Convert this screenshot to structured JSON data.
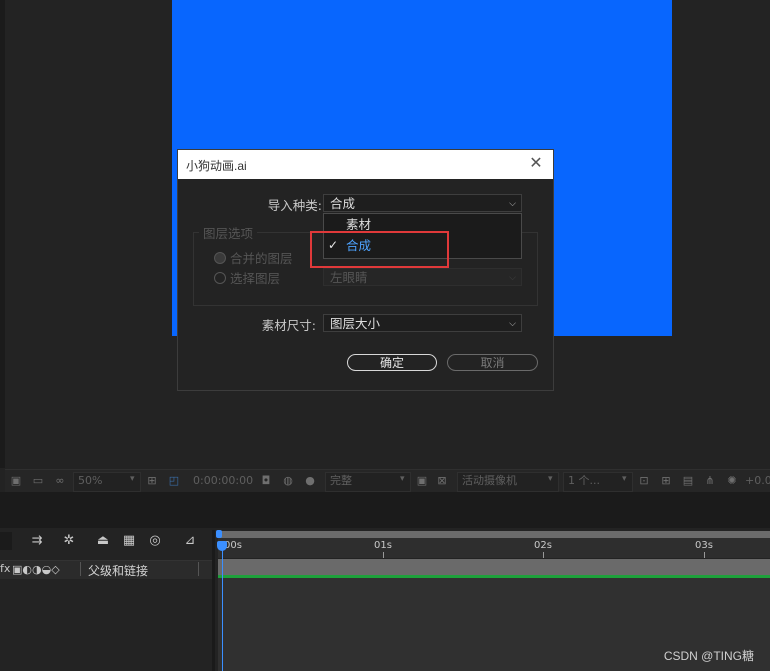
{
  "dialog": {
    "title": "小狗动画.ai",
    "close_glyph": "✕",
    "import_kind_label": "导入种类:",
    "import_kind_value": "合成",
    "layer_options_legend": "图层选项",
    "merge_layers_label": "合并的图层",
    "choose_layers_label": "选择图层",
    "layer_select_value": "左眼睛",
    "footage_size_label": "素材尺寸:",
    "footage_size_value": "图层大小",
    "ok_label": "确定",
    "cancel_label": "取消",
    "dropdown_options": [
      {
        "label": "素材",
        "checked": false
      },
      {
        "label": "合成",
        "checked": true
      }
    ],
    "check_glyph": "✓"
  },
  "viewer_toolbar": {
    "zoom_value": "50%",
    "timecode": "0:00:00:00",
    "resolution_value": "完整",
    "camera_value": "活动摄像机",
    "views_value": "1 个...",
    "exposure_value": "+0.0"
  },
  "timeline": {
    "column_header": "父级和链接",
    "column_switches": "fx",
    "ticks": [
      "00s",
      "01s",
      "02s",
      "03s"
    ]
  },
  "watermark": "CSDN @TING糖",
  "colors": {
    "canvas_blue": "#0866fe",
    "playhead_blue": "#3b8fff",
    "annotation_red": "#e0393a",
    "track_green": "#1ea13b"
  }
}
